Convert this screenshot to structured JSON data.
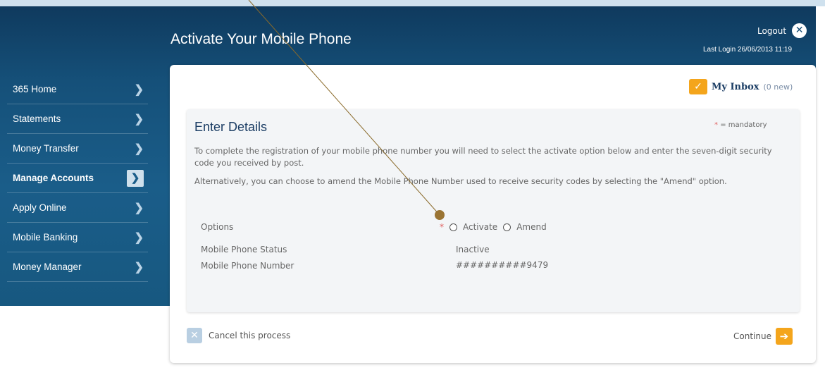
{
  "header": {
    "page_title": "Activate Your Mobile Phone",
    "logout_label": "Logout",
    "last_login": "Last Login 26/06/2013 11:19"
  },
  "sidebar": {
    "items": [
      {
        "label": "365 Home"
      },
      {
        "label": "Statements"
      },
      {
        "label": "Money Transfer"
      },
      {
        "label": "Manage Accounts",
        "active": true
      },
      {
        "label": "Apply Online"
      },
      {
        "label": "Mobile Banking"
      },
      {
        "label": "Money Manager"
      }
    ]
  },
  "inbox": {
    "label": "My Inbox",
    "count": "(0 new)"
  },
  "details": {
    "title": "Enter Details",
    "mandatory_note": "= mandatory",
    "paragraph1": "To complete the registration of your mobile phone number you will need to select the activate option below and enter the seven-digit security code you received by post.",
    "paragraph2": "Alternatively, you can choose to amend the Mobile Phone Number used to receive security codes by selecting the \"Amend\" option.",
    "options_label": "Options",
    "option_activate": "Activate",
    "option_amend": "Amend",
    "status_label": "Mobile Phone Status",
    "status_value": "Inactive",
    "number_label": "Mobile Phone Number",
    "number_value": "##########9479"
  },
  "footer": {
    "cancel_label": "Cancel this process",
    "continue_label": "Continue"
  },
  "colors": {
    "banner": "#155079",
    "accent_orange": "#f4a51c",
    "title_blue": "#1b3d64",
    "pointer": "#8a6a2a"
  }
}
